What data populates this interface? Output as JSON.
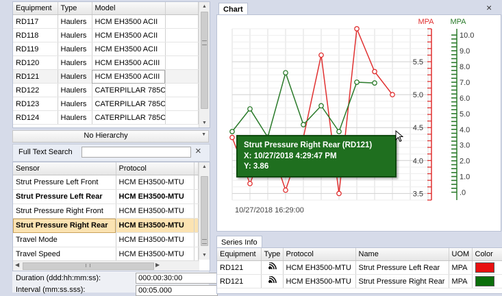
{
  "equipment": {
    "columns": [
      "Equipment",
      "Type",
      "Model"
    ],
    "rows": [
      [
        "RD117",
        "Haulers",
        "HCM EH3500 ACII"
      ],
      [
        "RD118",
        "Haulers",
        "HCM EH3500 ACII"
      ],
      [
        "RD119",
        "Haulers",
        "HCM EH3500 ACII"
      ],
      [
        "RD120",
        "Haulers",
        "HCM EH3500 ACIII"
      ],
      [
        "RD121",
        "Haulers",
        "HCM EH3500 ACIII"
      ],
      [
        "RD122",
        "Haulers",
        "CATERPILLAR 785C"
      ],
      [
        "RD123",
        "Haulers",
        "CATERPILLAR 785C"
      ],
      [
        "RD124",
        "Haulers",
        "CATERPILLAR 785C"
      ]
    ],
    "selected_index": 4
  },
  "hierarchy": {
    "label": "No Hierarchy"
  },
  "search": {
    "label": "Full Text Search",
    "value": "",
    "clear_glyph": "×"
  },
  "sensors": {
    "columns": [
      "Sensor",
      "Protocol"
    ],
    "rows": [
      {
        "sensor": "Strut Pressure Left Front",
        "protocol": "HCM EH3500-MTU",
        "bold": false,
        "hl": false
      },
      {
        "sensor": "Strut Pressure Left Rear",
        "protocol": "HCM EH3500-MTU",
        "bold": true,
        "hl": false
      },
      {
        "sensor": "Strut Pressure Right Front",
        "protocol": "HCM EH3500-MTU",
        "bold": false,
        "hl": false
      },
      {
        "sensor": "Strut Pressure Right Rear",
        "protocol": "HCM EH3500-MTU",
        "bold": true,
        "hl": true
      },
      {
        "sensor": "Travel Mode",
        "protocol": "HCM EH3500-MTU",
        "bold": false,
        "hl": false
      },
      {
        "sensor": "Travel Speed",
        "protocol": "HCM EH3500-MTU",
        "bold": false,
        "hl": false
      }
    ]
  },
  "settings": {
    "duration_label": "Duration (ddd:hh:mm:ss):",
    "duration_value": "000:00:30:00",
    "interval_label": "Interval (mm:ss.sss):",
    "interval_value": "00:05.000"
  },
  "chart_panel": {
    "tab_label": "Chart",
    "close_glyph": "×"
  },
  "chart_data": {
    "type": "line",
    "x_label_shown": "10/27/2018 16:29:00",
    "left_axis": {
      "unit": "MPA",
      "color": "#e03030",
      "range": [
        3.4,
        6.0
      ],
      "ticks": [
        3.5,
        4.0,
        4.5,
        5.0,
        5.5
      ]
    },
    "right_axis": {
      "unit": "MPA",
      "color": "#2a7a2a",
      "range": [
        -0.5,
        10.4
      ],
      "ticks": [
        0,
        1.0,
        2.0,
        3.0,
        4.0,
        5.0,
        6.0,
        7.0,
        8.0,
        9.0,
        10.0
      ]
    },
    "series": [
      {
        "name": "Strut Pressure Left Rear",
        "color": "#e03030",
        "axis": "left",
        "x": [
          0,
          1,
          2,
          3,
          4,
          5,
          6,
          7,
          8,
          9,
          10,
          11
        ],
        "values": [
          4.35,
          3.65,
          4.35,
          3.55,
          4.35,
          5.6,
          3.5,
          6.0,
          5.35,
          5.0,
          null,
          null
        ]
      },
      {
        "name": "Strut Pressure Right Rear",
        "color": "#2a7a2a",
        "axis": "right",
        "x": [
          0,
          1,
          2,
          3,
          4,
          5,
          6,
          7,
          8,
          9,
          10,
          11
        ],
        "values": [
          3.86,
          5.3,
          3.5,
          7.6,
          4.3,
          5.5,
          3.86,
          7.0,
          6.95,
          null,
          null,
          null
        ]
      }
    ]
  },
  "tooltip": {
    "title": "Strut Pressure Right Rear (RD121)",
    "x_text": "X:  10/27/2018 4:29:47 PM",
    "y_text": "Y:  3.86"
  },
  "series_info": {
    "tab_label": "Series Info",
    "columns": [
      "Equipment",
      "Type",
      "Protocol",
      "Name",
      "UOM",
      "Color"
    ],
    "rows": [
      {
        "equipment": "RD121",
        "type_icon": "signal-icon",
        "protocol": "HCM EH3500-MTU",
        "name": "Strut Pressure Left Rear",
        "uom": "MPA",
        "color": "#e81010"
      },
      {
        "equipment": "RD121",
        "type_icon": "signal-icon",
        "protocol": "HCM EH3500-MTU",
        "name": "Strut Pressure Right Rear",
        "uom": "MPA",
        "color": "#0b6e0b"
      }
    ]
  }
}
